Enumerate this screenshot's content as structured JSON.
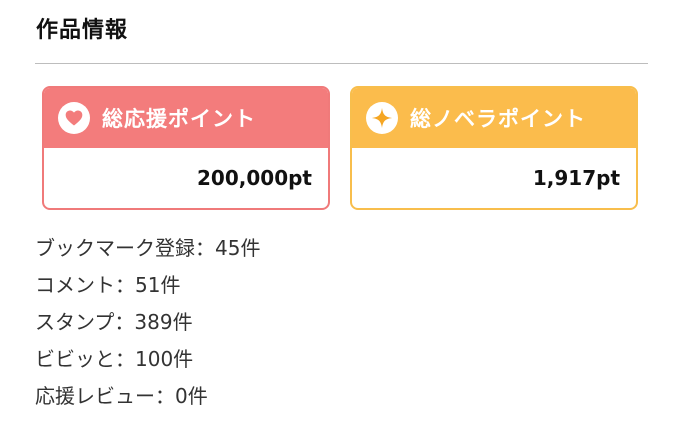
{
  "section": {
    "title": "作品情報"
  },
  "cards": {
    "support": {
      "label": "総応援ポイント",
      "value": "200,000pt",
      "icon": "heart-icon",
      "color": "#f37c7c"
    },
    "novera": {
      "label": "総ノベラポイント",
      "value": "1,917pt",
      "icon": "sparkle-star-icon",
      "color": "#fbbc4c"
    }
  },
  "stats": [
    {
      "label": "ブックマーク登録",
      "value": "45件"
    },
    {
      "label": "コメント",
      "value": "51件"
    },
    {
      "label": "スタンプ",
      "value": "389件"
    },
    {
      "label": "ビビッと",
      "value": "100件"
    },
    {
      "label": "応援レビュー",
      "value": "0件"
    }
  ],
  "separator": "："
}
